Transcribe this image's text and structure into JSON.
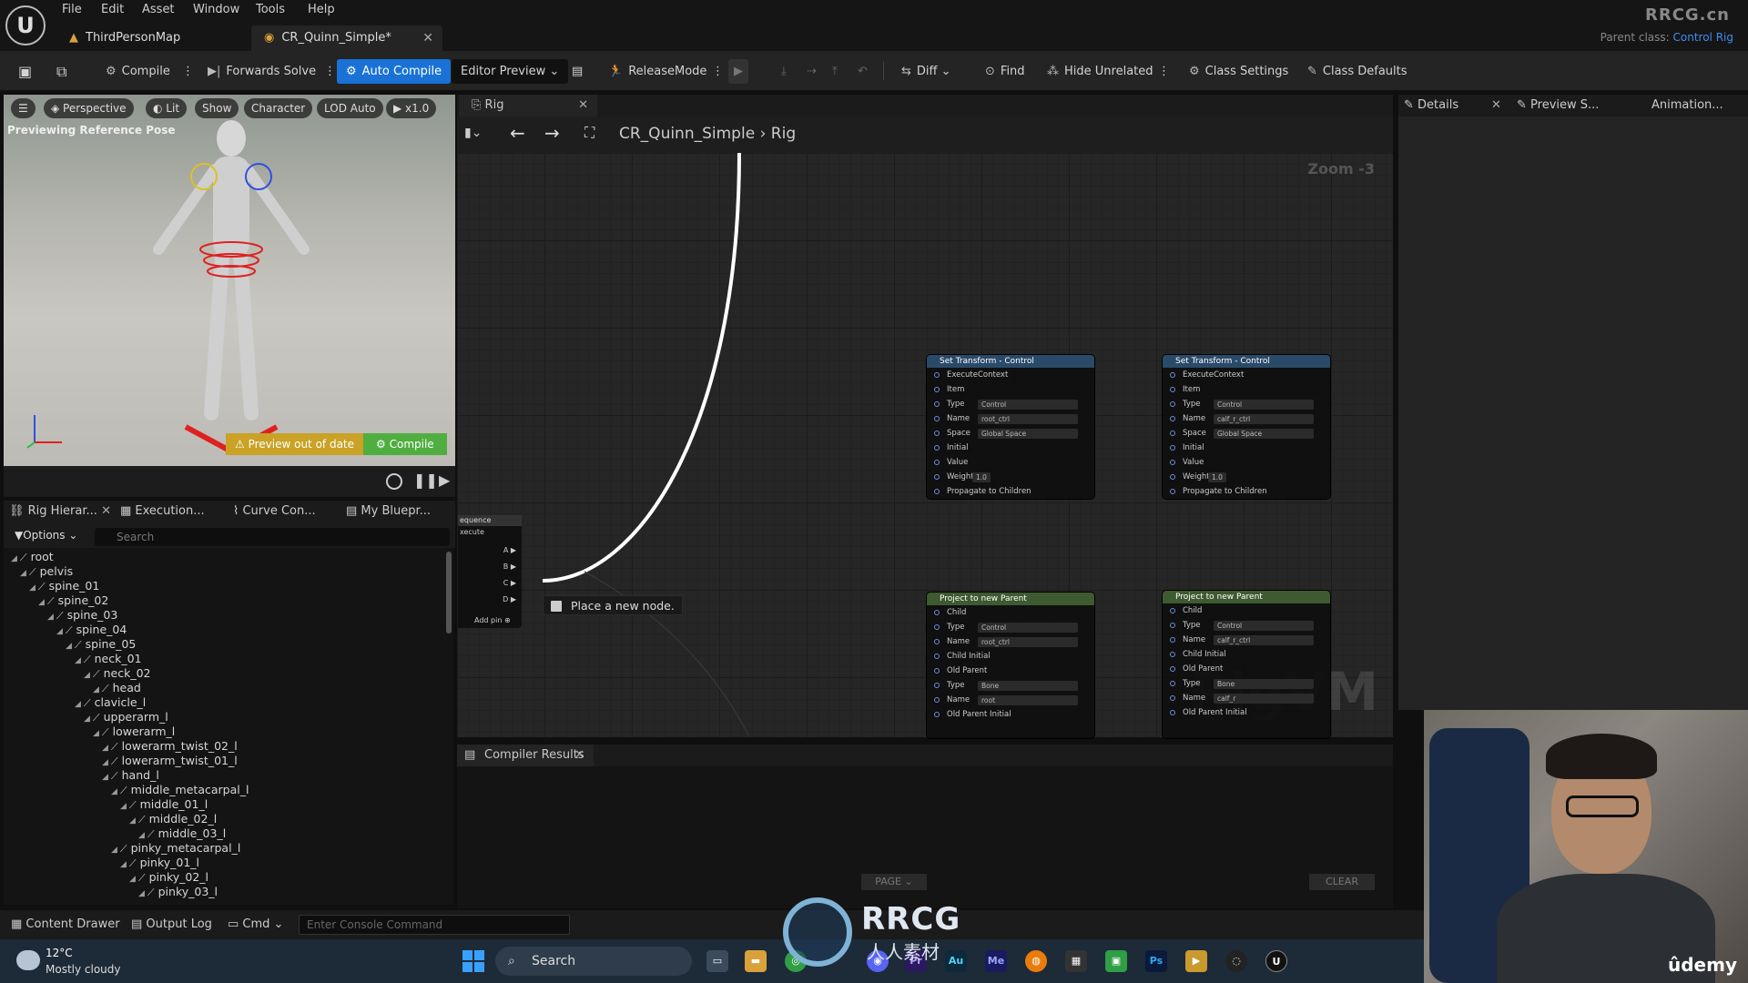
{
  "menu": {
    "items": [
      "File",
      "Edit",
      "Asset",
      "Window",
      "Tools",
      "Help"
    ]
  },
  "doc_tabs": {
    "map": "ThirdPersonMap",
    "rig": "CR_Quinn_Simple*"
  },
  "window": {
    "watermark": "RRCG.cn",
    "parent_class_label": "Parent class:",
    "parent_class_value": "Control Rig"
  },
  "toolbar": {
    "compile": "Compile",
    "forwards_solve": "Forwards Solve",
    "auto_compile": "Auto Compile",
    "editor_preview": "Editor Preview",
    "release_mode": "ReleaseMode",
    "diff": "Diff",
    "find": "Find",
    "hide_unrelated": "Hide Unrelated",
    "class_settings": "Class Settings",
    "class_defaults": "Class Defaults"
  },
  "viewport": {
    "perspective": "Perspective",
    "lit": "Lit",
    "show": "Show",
    "character": "Character",
    "lod": "LOD Auto",
    "speed": "x1.0",
    "label": "Previewing Reference Pose",
    "preview_out_of_date": "Preview out of date",
    "compile": "Compile"
  },
  "left_tabs": {
    "rig_hierarchy": "Rig Hierar...",
    "execution": "Execution...",
    "curve": "Curve Con...",
    "my_blueprint": "My Bluepr..."
  },
  "left_search": {
    "options": "Options",
    "placeholder": "Search"
  },
  "hierarchy": [
    {
      "name": "root",
      "depth": 0
    },
    {
      "name": "pelvis",
      "depth": 1
    },
    {
      "name": "spine_01",
      "depth": 2
    },
    {
      "name": "spine_02",
      "depth": 3
    },
    {
      "name": "spine_03",
      "depth": 4
    },
    {
      "name": "spine_04",
      "depth": 5
    },
    {
      "name": "spine_05",
      "depth": 6
    },
    {
      "name": "neck_01",
      "depth": 7
    },
    {
      "name": "neck_02",
      "depth": 8
    },
    {
      "name": "head",
      "depth": 9
    },
    {
      "name": "clavicle_l",
      "depth": 7
    },
    {
      "name": "upperarm_l",
      "depth": 8
    },
    {
      "name": "lowerarm_l",
      "depth": 9
    },
    {
      "name": "lowerarm_twist_02_l",
      "depth": 10
    },
    {
      "name": "lowerarm_twist_01_l",
      "depth": 10
    },
    {
      "name": "hand_l",
      "depth": 10
    },
    {
      "name": "middle_metacarpal_l",
      "depth": 11
    },
    {
      "name": "middle_01_l",
      "depth": 12
    },
    {
      "name": "middle_02_l",
      "depth": 13
    },
    {
      "name": "middle_03_l",
      "depth": 14
    },
    {
      "name": "pinky_metacarpal_l",
      "depth": 11
    },
    {
      "name": "pinky_01_l",
      "depth": 12
    },
    {
      "name": "pinky_02_l",
      "depth": 13
    },
    {
      "name": "pinky_03_l",
      "depth": 14
    }
  ],
  "graph": {
    "tab": "Rig",
    "breadcrumb_asset": "CR_Quinn_Simple",
    "breadcrumb_graph": "Rig",
    "zoom": "Zoom -3",
    "watermark": "RigVM",
    "tooltip": "Place a new node.",
    "sequence": {
      "title": "equence",
      "execute": "xecute",
      "pins": [
        "A",
        "B",
        "C",
        "D"
      ],
      "add_pin": "Add pin"
    },
    "nodes": [
      {
        "title": "Set Transform - Control",
        "rows": [
          {
            "label": "ExecuteContext",
            "field": ""
          },
          {
            "label": "Item",
            "field": ""
          },
          {
            "label": "Type",
            "field": "Control"
          },
          {
            "label": "Name",
            "field": "root_ctrl"
          },
          {
            "label": "Space",
            "field": "Global Space"
          },
          {
            "label": "Initial",
            "field": ""
          },
          {
            "label": "Value",
            "field": ""
          },
          {
            "label": "Weight",
            "field": "1.0"
          },
          {
            "label": "Propagate to Children",
            "field": ""
          }
        ]
      },
      {
        "title": "Set Transform - Control",
        "rows": [
          {
            "label": "ExecuteContext",
            "field": ""
          },
          {
            "label": "Item",
            "field": ""
          },
          {
            "label": "Type",
            "field": "Control"
          },
          {
            "label": "Name",
            "field": "calf_r_ctrl"
          },
          {
            "label": "Space",
            "field": "Global Space"
          },
          {
            "label": "Initial",
            "field": ""
          },
          {
            "label": "Value",
            "field": ""
          },
          {
            "label": "Weight",
            "field": "1.0"
          },
          {
            "label": "Propagate to Children",
            "field": ""
          }
        ]
      },
      {
        "title": "Project to new Parent",
        "rows": [
          {
            "label": "Child",
            "field": ""
          },
          {
            "label": "Type",
            "field": "Control"
          },
          {
            "label": "Name",
            "field": "root_ctrl"
          },
          {
            "label": "Child Initial",
            "field": ""
          },
          {
            "label": "Old Parent",
            "field": ""
          },
          {
            "label": "Type",
            "field": "Bone"
          },
          {
            "label": "Name",
            "field": "root"
          },
          {
            "label": "Old Parent Initial",
            "field": ""
          }
        ]
      },
      {
        "title": "Project to new Parent",
        "rows": [
          {
            "label": "Child",
            "field": ""
          },
          {
            "label": "Type",
            "field": "Control"
          },
          {
            "label": "Name",
            "field": "calf_r_ctrl"
          },
          {
            "label": "Child Initial",
            "field": ""
          },
          {
            "label": "Old Parent",
            "field": ""
          },
          {
            "label": "Type",
            "field": "Bone"
          },
          {
            "label": "Name",
            "field": "calf_r"
          },
          {
            "label": "Old Parent Initial",
            "field": ""
          }
        ]
      }
    ]
  },
  "compiler": {
    "tab": "Compiler Results",
    "page": "PAGE",
    "clear": "CLEAR"
  },
  "right_tabs": {
    "details": "Details",
    "preview": "Preview S...",
    "animation": "Animation..."
  },
  "bottom": {
    "content_drawer": "Content Drawer",
    "output_log": "Output Log",
    "cmd": "Cmd",
    "console_placeholder": "Enter Console Command"
  },
  "taskbar": {
    "temp": "12°C",
    "weather": "Mostly cloudy",
    "search": "Search",
    "apps": [
      "Pr",
      "Au",
      "Me",
      "Ps"
    ]
  },
  "overlay": {
    "rrcg": "RRCG",
    "rrcg_sub": "人人素材",
    "udemy": "ûdemy"
  }
}
